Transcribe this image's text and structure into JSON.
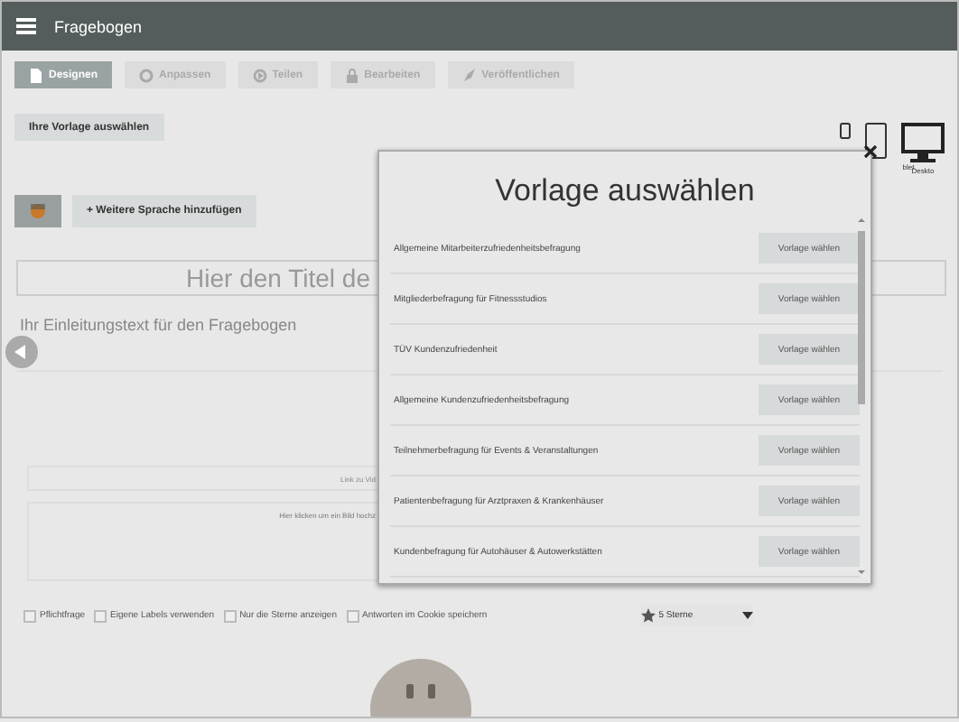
{
  "app_bar": {
    "title": "Fragebogen"
  },
  "steps": [
    {
      "label": "Designen",
      "selected": true
    },
    {
      "label": "Anpassen",
      "selected": false
    },
    {
      "label": "Teilen",
      "selected": false
    },
    {
      "label": "Bearbeiten",
      "selected": false
    },
    {
      "label": "Veröffentlichen",
      "selected": false
    }
  ],
  "template_button": "Ihre Vorlage auswählen",
  "devices": [
    {
      "kind": "phone"
    },
    {
      "kind": "tablet",
      "label": "blet"
    },
    {
      "kind": "desktop",
      "label": "Deskto"
    }
  ],
  "language_button": "+ Weitere Sprache hinzufügen",
  "title_field": {
    "placeholder": "Hier den Titel de"
  },
  "intro_text": "Ihr Einleitungstext für den Fragebogen",
  "video_field": {
    "placeholder": "Link zu Vid"
  },
  "image_area": {
    "placeholder": "Hier klicken um ein Bild hochz"
  },
  "options": [
    {
      "label": "Pflichtfrage",
      "checked": false
    },
    {
      "label": "Eigene Labels verwenden",
      "checked": false
    },
    {
      "label": "Nur die Sterne anzeigen",
      "checked": false
    },
    {
      "label": "Antworten im Cookie speichern",
      "checked": false
    }
  ],
  "rating_select": {
    "value": "5 Sterne"
  },
  "modal": {
    "title": "Vorlage auswählen",
    "templates": [
      {
        "name": "Allgemeine Mitarbeiterzufriedenheitsbefragung",
        "button": "Vorlage wählen"
      },
      {
        "name": "Mitgliederbefragung für Fitnessstudios",
        "button": "Vorlage wählen"
      },
      {
        "name": "TÜV Kundenzufriedenheit",
        "button": "Vorlage wählen"
      },
      {
        "name": "Allgemeine Kundenzufriedenheitsbefragung",
        "button": "Vorlage wählen"
      },
      {
        "name": "Teilnehmerbefragung für Events & Veranstaltungen",
        "button": "Vorlage wählen"
      },
      {
        "name": "Patientenbefragung für Arztpraxen & Krankenhäuser",
        "button": "Vorlage wählen"
      },
      {
        "name": "Kundenbefragung für Autohäuser & Autowerkstätten",
        "button": "Vorlage wählen"
      }
    ]
  }
}
